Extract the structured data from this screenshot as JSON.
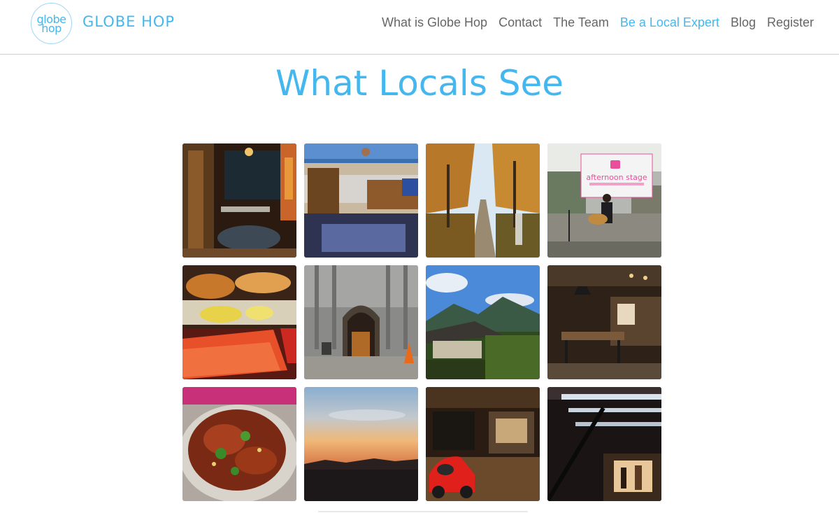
{
  "header": {
    "logo_text_top": "globe",
    "logo_text_bottom": "hop",
    "brand": "GLOBE HOP",
    "nav": [
      {
        "label": "What is Globe Hop",
        "active": false
      },
      {
        "label": "Contact",
        "active": false
      },
      {
        "label": "The Team",
        "active": false
      },
      {
        "label": "Be a Local Expert",
        "active": true
      },
      {
        "label": "Blog",
        "active": false
      },
      {
        "label": "Register",
        "active": false
      }
    ]
  },
  "main": {
    "title": "What Locals See",
    "photos": [
      {
        "name": "photo-restaurant-patio"
      },
      {
        "name": "photo-beach-deck"
      },
      {
        "name": "photo-autumn-path"
      },
      {
        "name": "photo-afternoon-stage",
        "sign_text": "afternoon stage"
      },
      {
        "name": "photo-seafood-platter"
      },
      {
        "name": "photo-gothic-building"
      },
      {
        "name": "photo-hanok-mountains"
      },
      {
        "name": "photo-shop-interior"
      },
      {
        "name": "photo-crab-dish"
      },
      {
        "name": "photo-sunset-sky"
      },
      {
        "name": "photo-red-beetle-car"
      },
      {
        "name": "photo-staircase-shop"
      }
    ]
  },
  "colors": {
    "accent": "#45b7ef",
    "nav_text": "#666666",
    "header_border": "#cfcfcf"
  }
}
